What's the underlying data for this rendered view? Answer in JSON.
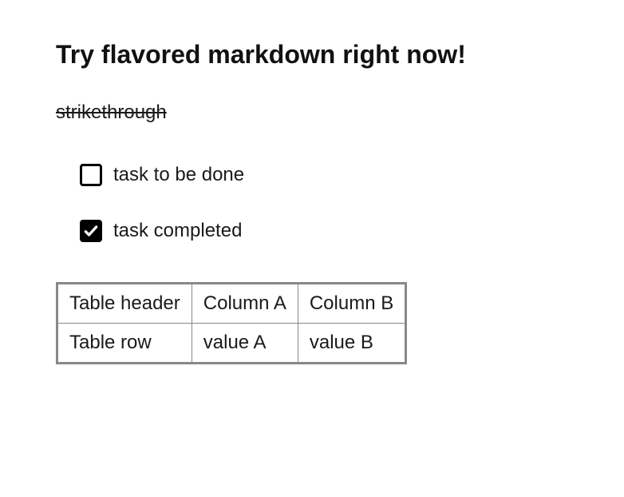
{
  "heading": "Try flavored markdown right now!",
  "strikethrough_text": "strikethrough",
  "tasks": [
    {
      "label": "task to be done",
      "checked": false
    },
    {
      "label": "task completed",
      "checked": true
    }
  ],
  "table": {
    "headers": [
      "Table header",
      "Column A",
      "Column B"
    ],
    "rows": [
      [
        "Table row",
        "value A",
        "value B"
      ]
    ]
  }
}
